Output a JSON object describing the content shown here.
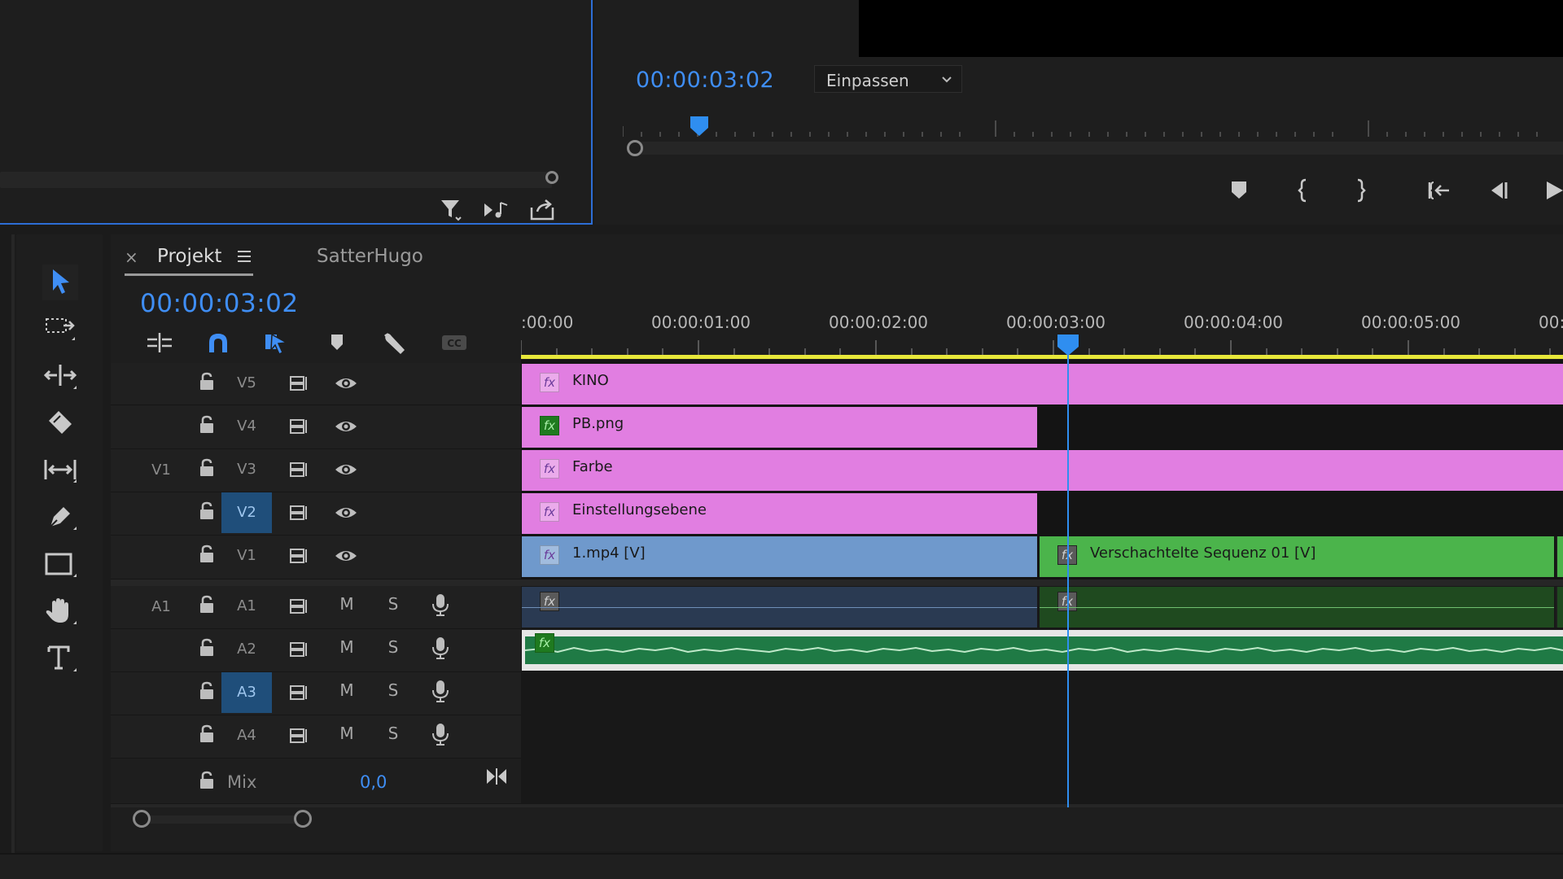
{
  "program_monitor": {
    "timecode": "00:00:03:02",
    "fit_dropdown": "Einpassen"
  },
  "timeline": {
    "tabs": [
      {
        "label": "Projekt",
        "active": true
      },
      {
        "label": "SatterHugo",
        "active": false
      }
    ],
    "timecode": "00:00:03:02",
    "ruler_labels": [
      ":00:00",
      "00:00:01:00",
      "00:00:02:00",
      "00:00:03:00",
      "00:00:04:00",
      "00:00:05:00",
      "00:"
    ],
    "video_tracks": [
      {
        "name": "V5",
        "source": ""
      },
      {
        "name": "V4",
        "source": ""
      },
      {
        "name": "V3",
        "source": "V1"
      },
      {
        "name": "V2",
        "source": "",
        "active": true
      },
      {
        "name": "V1",
        "source": ""
      }
    ],
    "audio_tracks": [
      {
        "name": "A1",
        "source": "A1"
      },
      {
        "name": "A2",
        "source": ""
      },
      {
        "name": "A3",
        "source": "",
        "active": true
      },
      {
        "name": "A4",
        "source": ""
      }
    ],
    "mute_label": "M",
    "solo_label": "S",
    "mix": {
      "label": "Mix",
      "value": "0,0"
    },
    "clips": [
      {
        "track": "V5",
        "label": "KINO"
      },
      {
        "track": "V4",
        "label": "PB.png"
      },
      {
        "track": "V3",
        "label": "Farbe"
      },
      {
        "track": "V2",
        "label": "Einstellungsebene"
      },
      {
        "track": "V1",
        "label": "1.mp4 [V]"
      },
      {
        "track": "V1",
        "label": "Verschachtelte Sequenz 01 [V]"
      }
    ],
    "fx_label": "fx"
  },
  "colors": {
    "accent_blue": "#3f8ef5",
    "clip_pink": "#e17ee1",
    "clip_blue": "#6f99cc",
    "clip_green": "#4bb44b",
    "audio_green": "#1f7a45",
    "work_area_yellow": "#e8e83a"
  }
}
